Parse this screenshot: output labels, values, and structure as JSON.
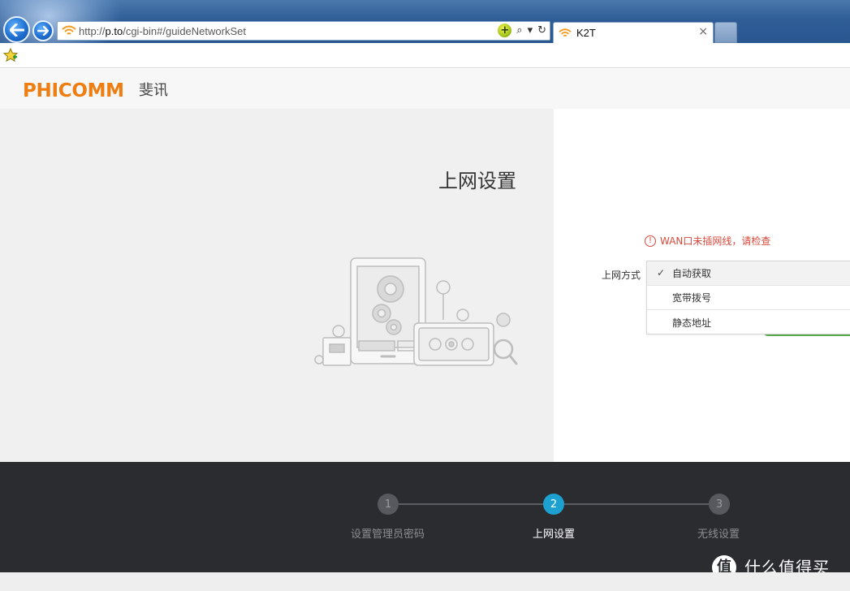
{
  "browser": {
    "url_prefix": "http://",
    "url_host": "p.to",
    "url_path": "/cgi-bin#/guideNetworkSet",
    "tab_title": "K2T",
    "tab_close": "×",
    "compat_glyph": "+",
    "search_glyph": "⌕",
    "dropdown_glyph": "▾",
    "refresh_glyph": "↻"
  },
  "header": {
    "logo": "PHICOMM",
    "logo_cn": "斐讯"
  },
  "main": {
    "title": "上网设置",
    "warning_icon": "!",
    "warning": "WAN口未插网线，请检查",
    "field_label": "上网方式",
    "check_glyph": "✓",
    "options": [
      {
        "label": "自动获取",
        "selected": true
      },
      {
        "label": "宽带拨号",
        "selected": false
      },
      {
        "label": "静态地址",
        "selected": false
      }
    ]
  },
  "steps": [
    {
      "number": "1",
      "label": "设置管理员密码",
      "active": false
    },
    {
      "number": "2",
      "label": "上网设置",
      "active": true
    },
    {
      "number": "3",
      "label": "无线设置",
      "active": false
    }
  ],
  "watermark": {
    "badge": "值",
    "text": "什么值得买"
  },
  "colors": {
    "brand_orange": "#ef7e12",
    "step_active": "#1da1d1",
    "warning_red": "#d7483a",
    "footer_bg": "#2b2c30",
    "accent_green": "#5bb04f"
  }
}
